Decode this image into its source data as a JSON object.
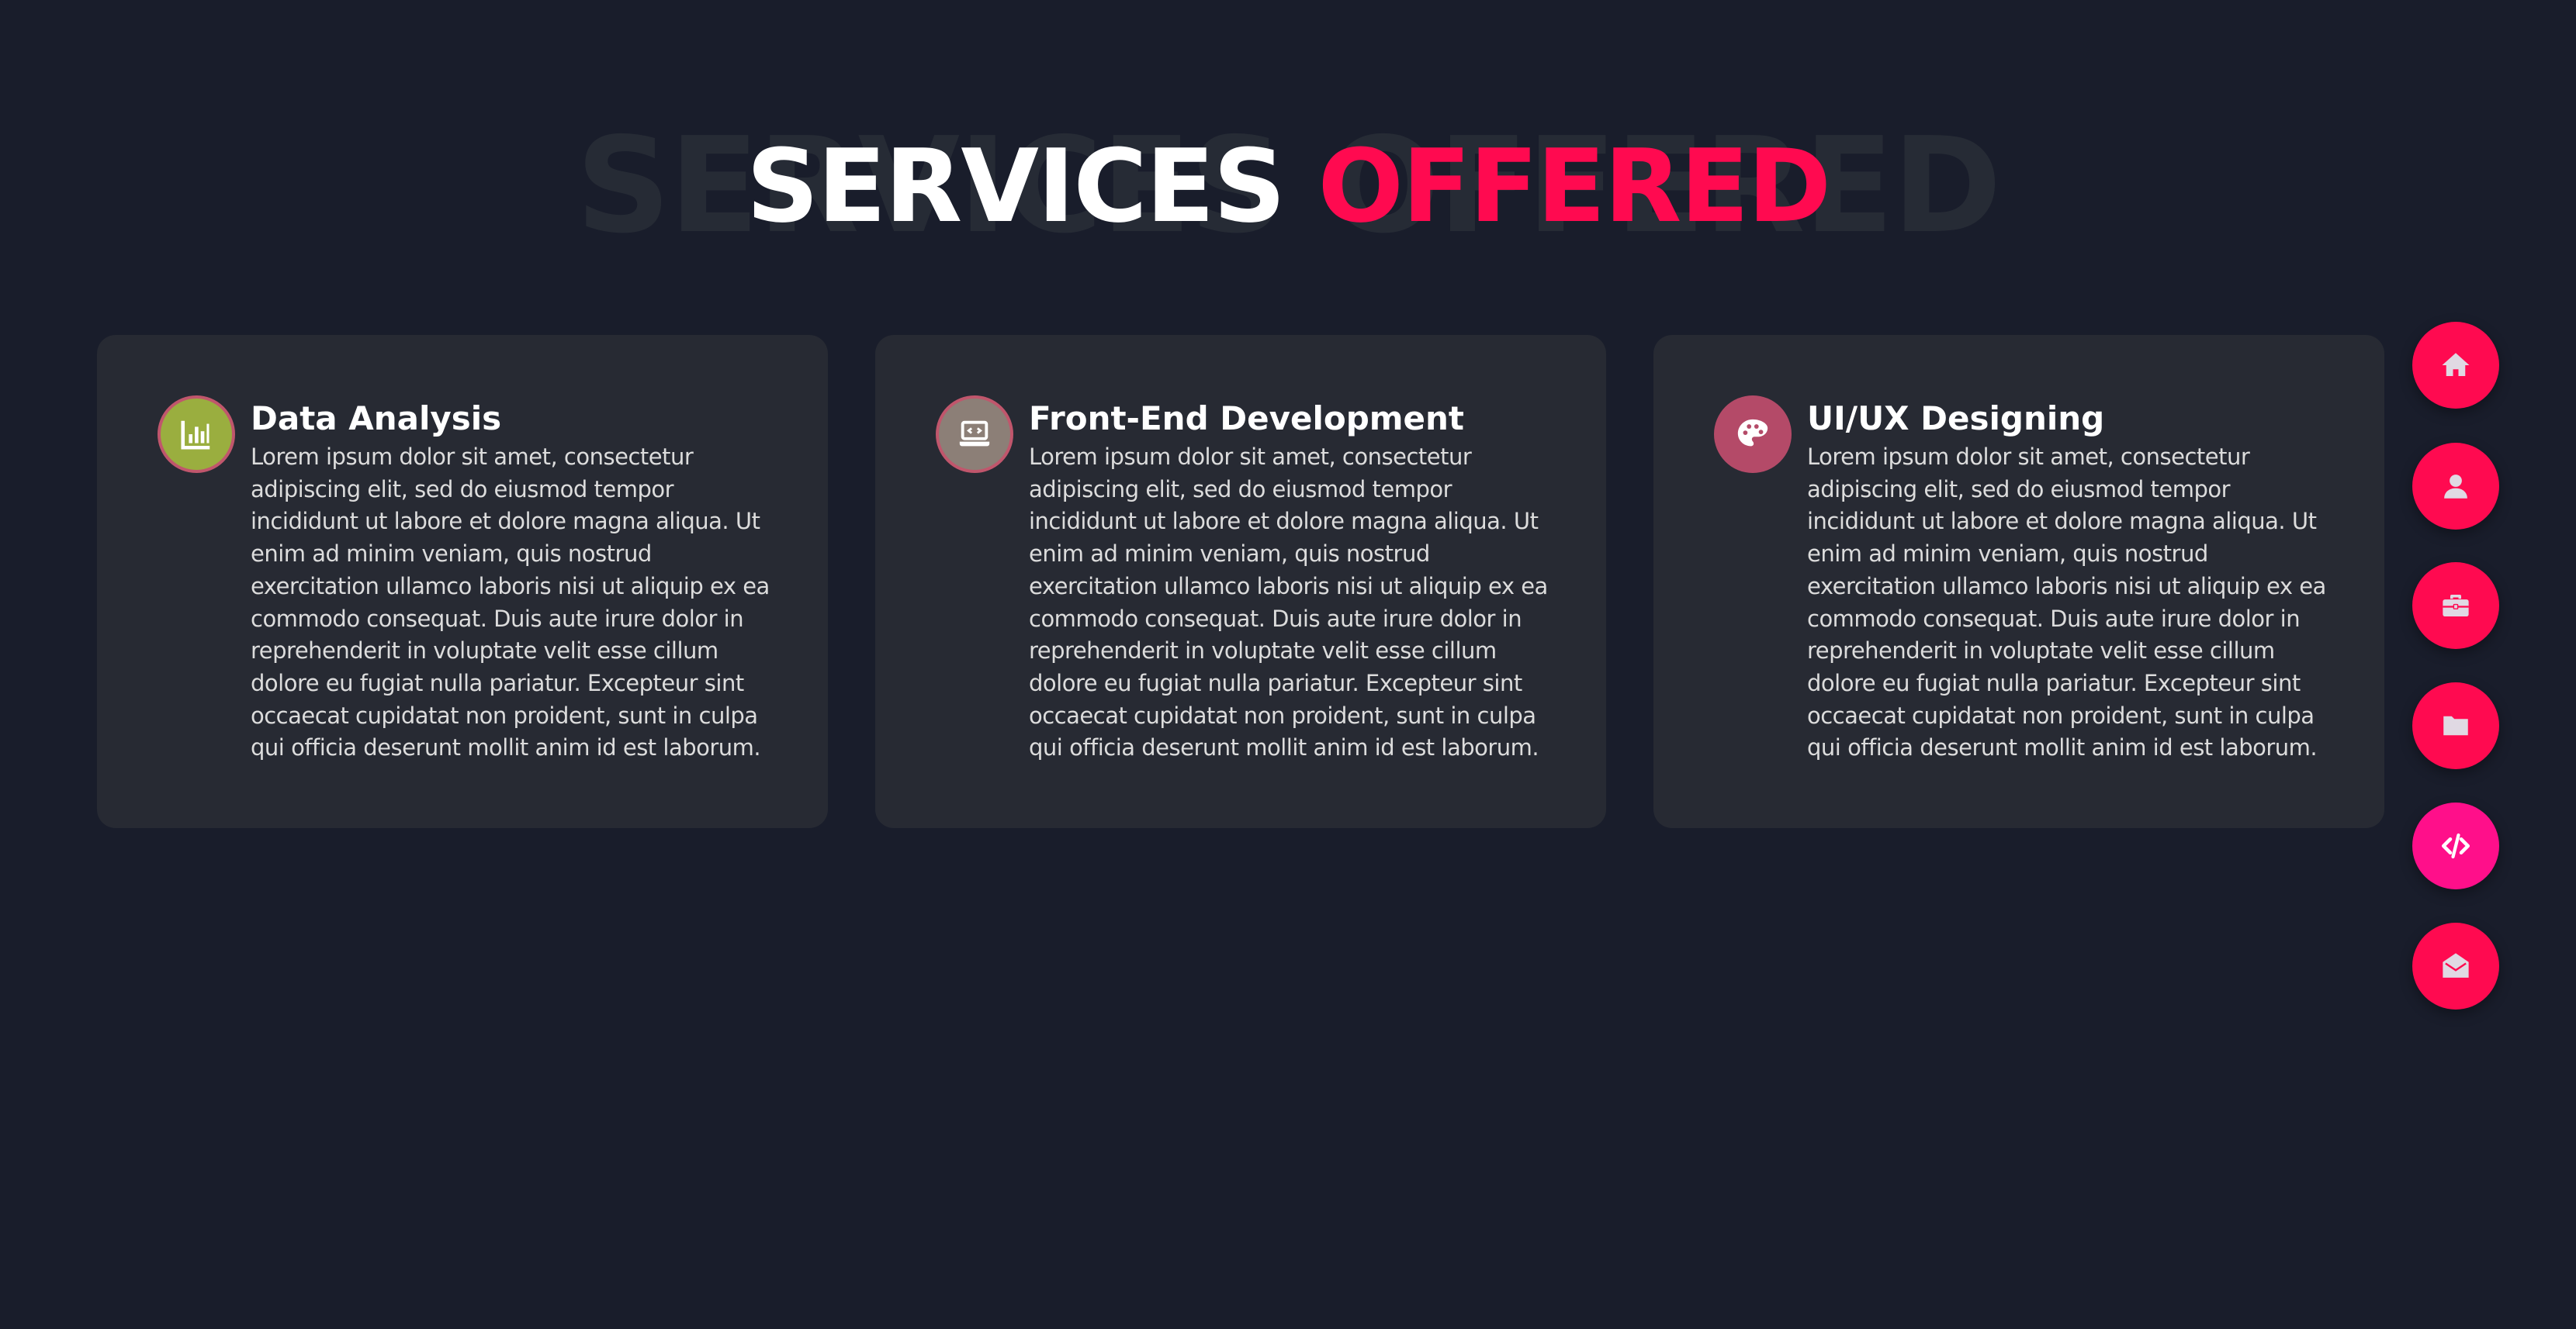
{
  "heading": {
    "background_text": "SERVICES OFFERED",
    "word_1": "SERVICES",
    "word_2": "OFFERED"
  },
  "services": [
    {
      "icon": "chart-icon",
      "title": "Data Analysis",
      "body": "Lorem ipsum dolor sit amet, consectetur adipiscing elit, sed do eiusmod tempor incididunt ut labore et dolore magna aliqua. Ut enim ad minim veniam, quis nostrud exercitation ullamco laboris nisi ut aliquip ex ea commodo consequat. Duis aute irure dolor in reprehenderit in voluptate velit esse cillum dolore eu fugiat nulla pariatur. Excepteur sint occaecat cupidatat non proident, sunt in culpa qui officia deserunt mollit anim id est laborum."
    },
    {
      "icon": "laptop-code-icon",
      "title": "Front-End Development",
      "body": "Lorem ipsum dolor sit amet, consectetur adipiscing elit, sed do eiusmod tempor incididunt ut labore et dolore magna aliqua. Ut enim ad minim veniam, quis nostrud exercitation ullamco laboris nisi ut aliquip ex ea commodo consequat. Duis aute irure dolor in reprehenderit in voluptate velit esse cillum dolore eu fugiat nulla pariatur. Excepteur sint occaecat cupidatat non proident, sunt in culpa qui officia deserunt mollit anim id est laborum."
    },
    {
      "icon": "palette-icon",
      "title": "UI/UX Designing",
      "body": "Lorem ipsum dolor sit amet, consectetur adipiscing elit, sed do eiusmod tempor incididunt ut labore et dolore magna aliqua. Ut enim ad minim veniam, quis nostrud exercitation ullamco laboris nisi ut aliquip ex ea commodo consequat. Duis aute irure dolor in reprehenderit in voluptate velit esse cillum dolore eu fugiat nulla pariatur. Excepteur sint occaecat cupidatat non proident, sunt in culpa qui officia deserunt mollit anim id est laborum."
    }
  ],
  "nav": {
    "items": [
      {
        "name": "home",
        "icon": "home-icon",
        "active": false
      },
      {
        "name": "about",
        "icon": "user-icon",
        "active": false
      },
      {
        "name": "experience",
        "icon": "briefcase-icon",
        "active": false
      },
      {
        "name": "portfolio",
        "icon": "folder-icon",
        "active": false
      },
      {
        "name": "services",
        "icon": "code-icon",
        "active": true
      },
      {
        "name": "contact",
        "icon": "envelope-open-icon",
        "active": false
      }
    ]
  },
  "colors": {
    "background": "#191d2b",
    "card": "#272a33",
    "accent": "#ff0a50",
    "active_nav": "#ff0f8a"
  }
}
